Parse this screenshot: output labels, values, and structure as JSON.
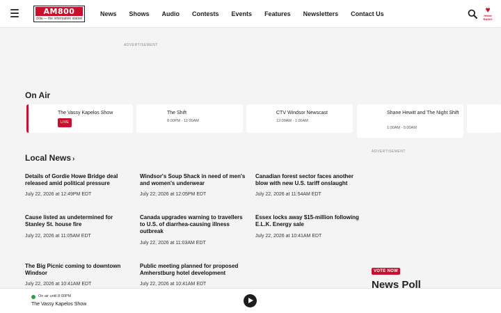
{
  "header": {
    "logo_main": "AM800",
    "logo_sub": "cklw — the information station",
    "nav": [
      "News",
      "Shows",
      "Audio",
      "Contests",
      "Events",
      "Features",
      "Newsletters",
      "Contact Us"
    ],
    "iheart_label": "iHeart RADIO"
  },
  "ads": {
    "top_label": "ADVERTISEMENT",
    "side_label": "ADVERTISEMENT"
  },
  "on_air": {
    "title": "On Air",
    "cards": [
      {
        "name": "The Vassy Kapelos Show",
        "badge": "LIVE"
      },
      {
        "name": "The Shift",
        "time": "8:00PM - 12:00AM"
      },
      {
        "name": "CTV Windsor Newscast",
        "time": "12:00AM - 1:00AM"
      },
      {
        "name": "Shane Hewitt and The Night Shift",
        "time": "1:00AM - 5:00AM"
      }
    ]
  },
  "local_news": {
    "title": "Local News",
    "chevron": "›",
    "items": [
      {
        "headline": "Details of Gordie Howe Bridge deal released amid political pressure",
        "time": "July 22, 2026 at 12:49PM EDT"
      },
      {
        "headline": "Windsor's Soup Shack in need of men's and women's underwear",
        "time": "July 22, 2026 at 12:05PM EDT"
      },
      {
        "headline": "Canadian forest sector faces another blow with new U.S. tariff onslaught",
        "time": "July 22, 2026 at 11:54AM EDT"
      },
      {
        "headline": "Cause listed as undetermined for Stanley St. house fire",
        "time": "July 22, 2026 at 11:05AM EDT"
      },
      {
        "headline": "Canada upgrades warning to travellers to U.S. of diarrhea-causing illness outbreak",
        "time": "July 22, 2026 at 11:03AM EDT"
      },
      {
        "headline": "Essex locks away $15-million following E.L.K. Energy sale",
        "time": "July 22, 2026 at 10:41AM EDT"
      },
      {
        "headline": "The Big Picnic coming to downtown Windsor",
        "time": "July 22, 2026 at 10:41AM EDT"
      },
      {
        "headline": "Public meeting planned for proposed Amherstburg hotel development",
        "time": "July 22, 2026 at 10:41AM EDT"
      }
    ]
  },
  "poll": {
    "badge": "VOTE NOW",
    "title": "News Poll"
  },
  "player": {
    "status": "On air until 8:00PM",
    "show": "The Vassy Kapelos Show"
  },
  "icons": {
    "menu": "hamburger-icon",
    "search": "search-icon",
    "play": "play-icon",
    "live_dot": "live-dot-icon"
  },
  "colors": {
    "accent": "#c8102e",
    "live": "#2ea043",
    "page_bg": "#f4f4f5"
  }
}
